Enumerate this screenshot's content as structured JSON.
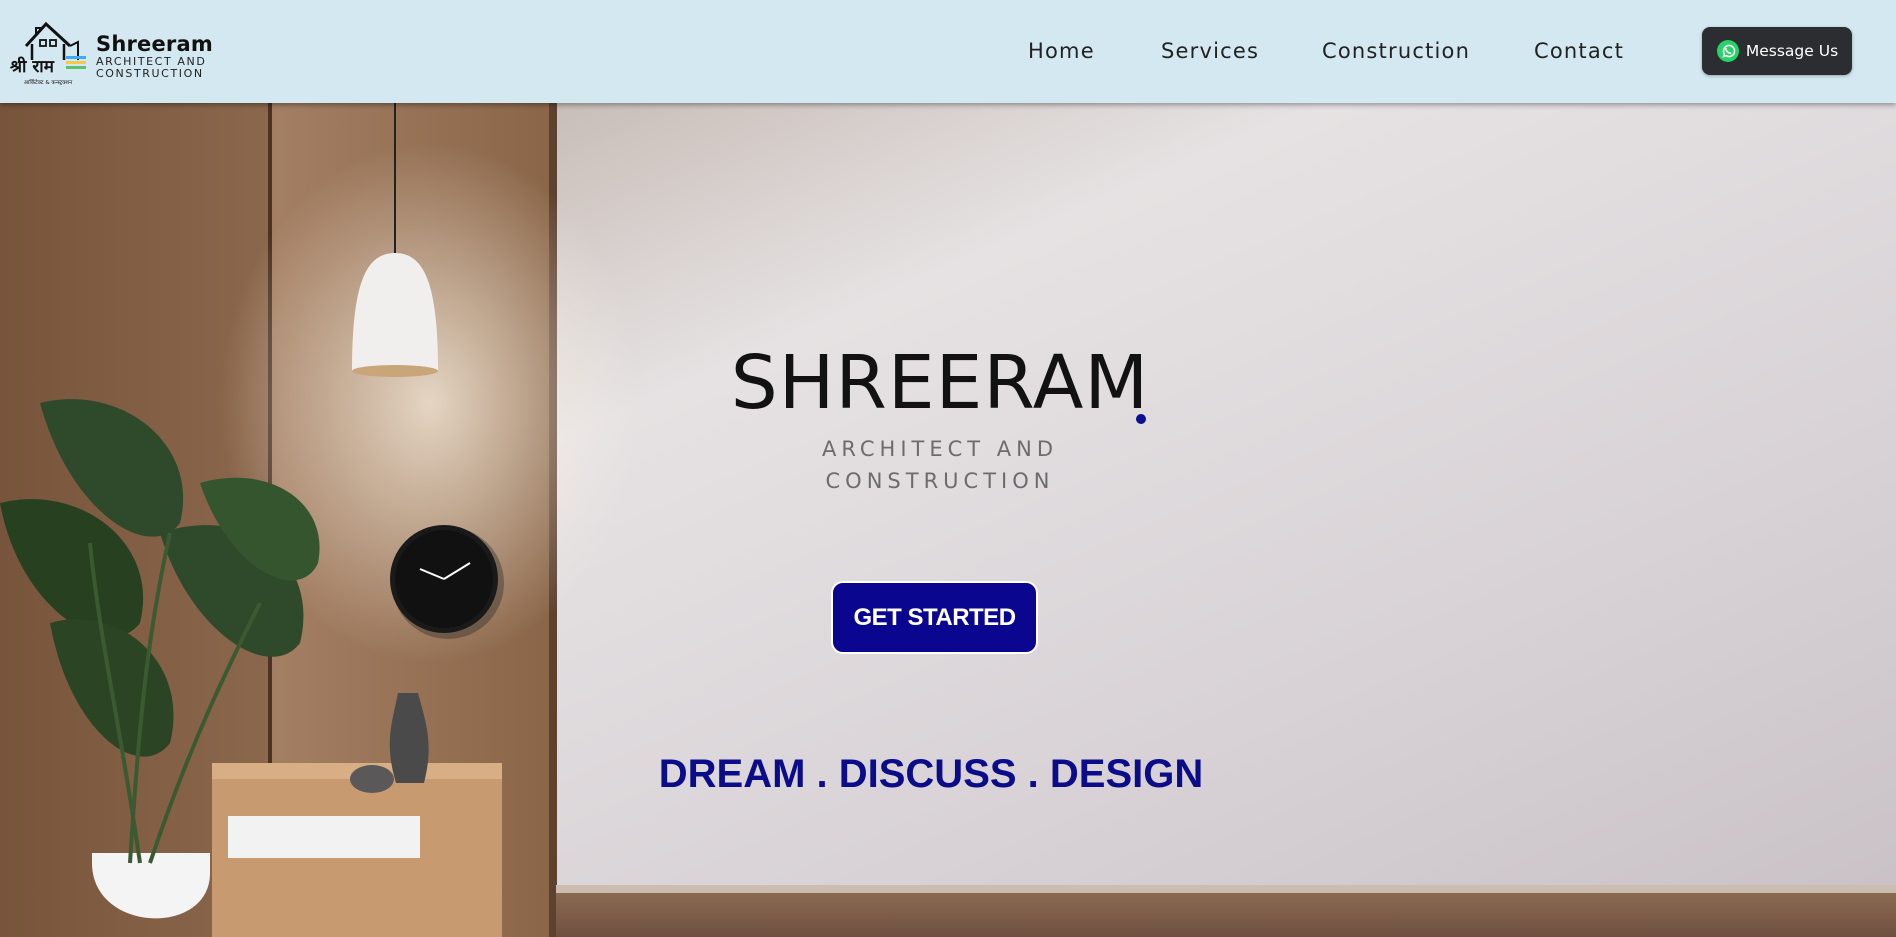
{
  "brand": {
    "name": "Shreeram",
    "sub_line1": "ARCHITECT AND",
    "sub_line2": "CONSTRUCTION",
    "mark_text": "श्री राम",
    "mark_subtext": "आर्किटेक्ट & कन्स्ट्रक्शन"
  },
  "nav": {
    "items": [
      {
        "label": "Home"
      },
      {
        "label": "Services"
      },
      {
        "label": "Construction"
      },
      {
        "label": "Contact"
      }
    ],
    "message_button": "Message Us"
  },
  "hero": {
    "title": "SHREERAM",
    "subtitle_line1": "ARCHITECT AND",
    "subtitle_line2": "CONSTRUCTION",
    "cta": "GET STARTED",
    "tagline": "DREAM . DISCUSS . DESIGN"
  },
  "icons": {
    "message": "whatsapp-icon"
  },
  "colors": {
    "header_bg": "#d3e8f0",
    "accent": "#0a0690",
    "tagline": "#0b0c8a",
    "message_button_bg": "#2b2d30"
  }
}
